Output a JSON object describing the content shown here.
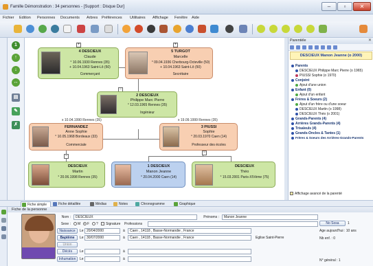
{
  "window": {
    "title": "Famille Démonstration : 34 personnes - [Support : Disque Dur]"
  },
  "menu": [
    "Fichier",
    "Edition",
    "Personnes",
    "Documents",
    "Arbres",
    "Préférences",
    "Utilitaires",
    "Affichage",
    "Fenêtre",
    "Aide"
  ],
  "tree": {
    "grandfather": {
      "num_name": "4 DESCIEUX",
      "given": "Claude",
      "birth": "° 10.06.1930 Rennes (35)",
      "death": "+ 10.04.1963 Saint-Lô (50)",
      "occupation": "Commerçant"
    },
    "grandmother": {
      "num_name": "5 TURGOT",
      "given": "Marcelle",
      "birth": "° 09.04.1936 Cherbourg-Octeville (50)",
      "death": "+ 10.04.1963 Saint-Lô (50)",
      "occupation": "Secrétaire"
    },
    "father": {
      "num_name": "2 DESCIEUX",
      "given": "Philippe Marc Pierre",
      "birth": "° 12.03.1965 Rennes (35)",
      "occupation": "Ingénieur"
    },
    "marriage_left": "x 10.04.1990 Rennes (35)",
    "marriage_right": "x 19.09.1999 Rennes (35)",
    "wife1": {
      "num_name": "FERNANDEZ",
      "given": "Anne Sophie",
      "birth": "° 10.05.1968 Bordeaux (33)",
      "occupation": "Commerciale"
    },
    "mother": {
      "num_name": "3 PIUSSI",
      "given": "Sophie",
      "birth": "° 20.03.1970 Caen (14)",
      "occupation": "Professeur des écoles"
    },
    "child1": {
      "num_name": "DESCIEUX",
      "given": "Martin",
      "birth": "° 20.06.1998 Rennes (35)"
    },
    "subject": {
      "num_name": "1 DESCIEUX",
      "given": "Manon Jeanne",
      "birth": "° 20.04.2000 Caen (14)"
    },
    "child3": {
      "num_name": "DESCIEUX",
      "given": "Théo",
      "birth": "° 15.03.2001 Paris-XIVème (75)"
    }
  },
  "relatives_panel": {
    "header": "Parentèle",
    "title": "DESCIEUX Manon Jeanne (o 2000)",
    "rows": [
      {
        "text": "Parents",
        "bold": true
      },
      {
        "text": "DESCIEUX Philippe Marc Pierre (o 1965)",
        "bold": false
      },
      {
        "text": "PIUSSI Sophie (o 1970)",
        "bold": false
      },
      {
        "text": "Conjoint",
        "bold": true
      },
      {
        "text": "Ajout d'une union",
        "bold": false
      },
      {
        "text": "Enfant (0)",
        "bold": true
      },
      {
        "text": "Ajout d'un enfant",
        "bold": false
      },
      {
        "text": "Frères & Soeurs (2)",
        "bold": true
      },
      {
        "text": "Ajout d'un frère ou d'une soeur",
        "bold": false
      },
      {
        "text": "DESCIEUX Martin (o 1998)",
        "bold": false
      },
      {
        "text": "DESCIEUX Théo (o 2001)",
        "bold": false
      },
      {
        "text": "Grands-Parents (4)",
        "bold": true
      },
      {
        "text": "Arrières Grands-Parents (4)",
        "bold": true
      },
      {
        "text": "Trisaïeuls (4)",
        "bold": true
      },
      {
        "text": "Grands-Oncles & Tantes (1)",
        "bold": true
      },
      {
        "text": "Frères & Soeurs des Arrières-Grands-Parents",
        "bold": true
      }
    ],
    "footer": "Affichage avancé de la parenté"
  },
  "tabs": [
    "Fiche simple",
    "Fiche détaillée",
    "Médias",
    "Notes",
    "Chronogramme",
    "Graphique"
  ],
  "form": {
    "header": "Fiche de la personne",
    "nom_label": "Nom :",
    "nom_value": "DESCIEUX",
    "prenoms_label": "Prénoms :",
    "prenoms_value": "Manon Jeanne",
    "sexe_label": "Sexe :",
    "sexe_m": "M",
    "sexe_f": "F",
    "sexe_q": "?",
    "signature_label": "Signature",
    "professions_label": "Professions",
    "naissance_btn": "Naissance",
    "naissance_date": "20/04/2000",
    "naissance_place": "Caen , 14118 , Basse-Normandie , France",
    "bapteme_btn": "Baptême",
    "bapteme_date": "30/07/2000",
    "bapteme_place": "Caen , 14118 , Basse-Normandie , France",
    "bapteme_church": "Eglise Saint-Pierre",
    "union_btn": "Union",
    "deces_btn": "Décès",
    "inhumation_btn": "Inhumation",
    "date_prefix": "Le",
    "no_sosa_btn": "No Sosa",
    "sosa_value": "1",
    "age_text": "Age aujourd'hui : 10 ans",
    "nb_enf": "Nb enf. : 0",
    "no_general": "N° général : 1"
  }
}
